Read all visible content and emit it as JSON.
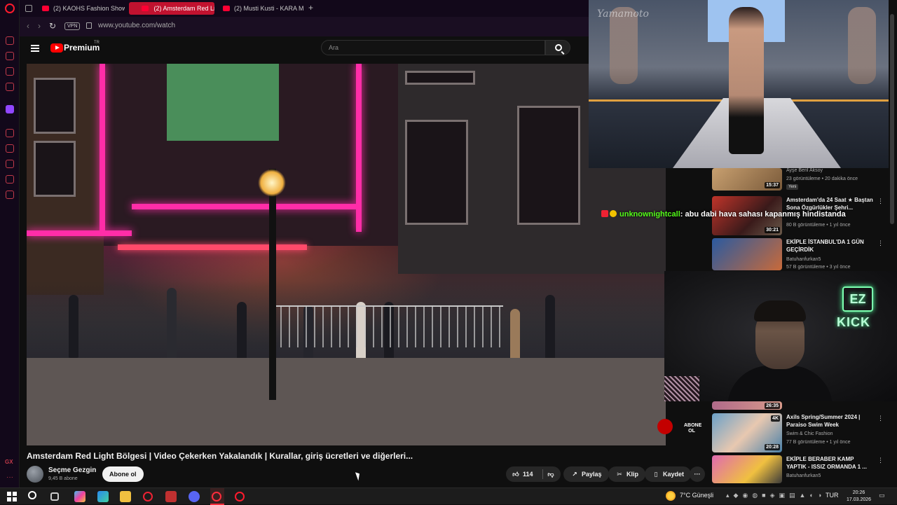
{
  "browser": {
    "tabs": [
      {
        "label": "(2) KAOHS Fashion Show",
        "active": false
      },
      {
        "label": "(2) Amsterdam Red Li...",
        "active": true
      },
      {
        "label": "(2) Musti Kusti - KARA Mİ...",
        "active": false
      }
    ],
    "new_tab_label": "+",
    "vpn_label": "VPN",
    "url": "www.youtube.com/watch",
    "sidebar_gx": "GX",
    "sidebar_more": "···"
  },
  "youtube": {
    "brand": "Premium",
    "brand_tm": "TR",
    "search_placeholder": "Ara"
  },
  "video": {
    "title": "Amsterdam Red Light Bölgesi | Video Çekerken Yakalandık | Kurallar, giriş ücretleri ve diğerleri...",
    "channel_name": "Seçme Gezgin",
    "subscribers": "9,45 B abone",
    "subscribe_label": "Abone ol",
    "like_count": "114",
    "share_label": "Paylaş",
    "clip_label": "Klip",
    "save_label": "Kaydet",
    "watermark_subscribe": "ABONE OL",
    "pip_watermark": "Yamamoto"
  },
  "chat": {
    "username": "unknownightcall",
    "message": ": abu dabi hava sahası kapanmış hindistanda"
  },
  "webcam": {
    "logo_text": "EZ",
    "platform_text": "KICK"
  },
  "related": [
    {
      "title": "",
      "channel": "Ayşe Beril Aksoy",
      "meta": "23 görüntüleme • 20 dakika önce",
      "duration": "15:37",
      "badge": "Yeni"
    },
    {
      "title": "Amsterdam'da 24 Saat ★ Baştan Sona Özgürlükler Şehri...",
      "channel": "",
      "meta": "80 B görüntüleme • 1 yıl önce",
      "duration": "30:21",
      "badge": ""
    },
    {
      "title": "EKİPLE İSTANBUL'DA 1 GÜN GEÇİRDİK",
      "channel": "Batuhanfurkan5",
      "meta": "57 B görüntüleme • 3 yıl önce",
      "duration": "",
      "badge": ""
    },
    {
      "title": "",
      "channel": "",
      "meta": "",
      "duration": "26:35",
      "badge": ""
    },
    {
      "title": "Axils Spring/Summer 2024 | Paraiso Swim Week",
      "channel": "Swim & Chic Fashion",
      "meta": "77 B görüntüleme • 1 yıl önce",
      "duration": "20:28",
      "badge": "4K"
    },
    {
      "title": "EKİPLE BERABER KAMP YAPTIK - ISSIZ ORMANDA 1 ...",
      "channel": "Batuhanfurkan5",
      "meta": "",
      "duration": "",
      "badge": ""
    }
  ],
  "taskbar": {
    "weather": "7°C  Güneşli",
    "lang": "TUR",
    "time": "20:26",
    "date": "17.03.2026"
  },
  "colors": {
    "accent": "#c1122f",
    "youtube_red": "#ff0000",
    "kick_green": "#53fc18"
  }
}
